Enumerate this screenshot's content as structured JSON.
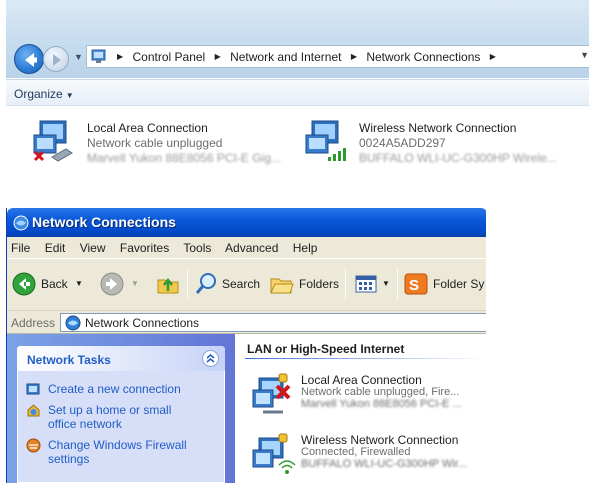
{
  "win7": {
    "breadcrumbs": [
      "Control Panel",
      "Network and Internet",
      "Network Connections"
    ],
    "toolbar": {
      "organize_label": "Organize"
    },
    "connections": [
      {
        "name": "Local Area Connection",
        "status": "Network cable unplugged",
        "device": "Marvell Yukon 88E8056 PCI-E Gig..."
      },
      {
        "name": "Wireless Network Connection",
        "status": "0024A5ADD297",
        "device": "BUFFALO WLI-UC-G300HP Wirele..."
      }
    ]
  },
  "winxp": {
    "window_title": "Network Connections",
    "menu": [
      "File",
      "Edit",
      "View",
      "Favorites",
      "Tools",
      "Advanced",
      "Help"
    ],
    "toolbar": {
      "back_label": "Back",
      "search_label": "Search",
      "folders_label": "Folders",
      "folder_sync_label": "Folder Sy"
    },
    "address": {
      "label": "Address",
      "value": "Network Connections"
    },
    "tasks": {
      "title": "Network Tasks",
      "links": [
        "Create a new connection",
        "Set up a home or small",
        "office network",
        "Change Windows Firewall",
        "settings"
      ]
    },
    "group_title": "LAN or High-Speed Internet",
    "connections": [
      {
        "name": "Local Area Connection",
        "status": "Network cable unplugged, Fire...",
        "device": "Marvell Yukon 88E8056 PCI-E ..."
      },
      {
        "name": "Wireless Network Connection",
        "status": "Connected, Firewalled",
        "device": "BUFFALO WLI-UC-G300HP Wir..."
      }
    ]
  },
  "colors": {
    "xp_title_blue": "#0a58d8",
    "xp_task_link": "#215dc6",
    "w7_address_bg": "#c6dcef"
  }
}
